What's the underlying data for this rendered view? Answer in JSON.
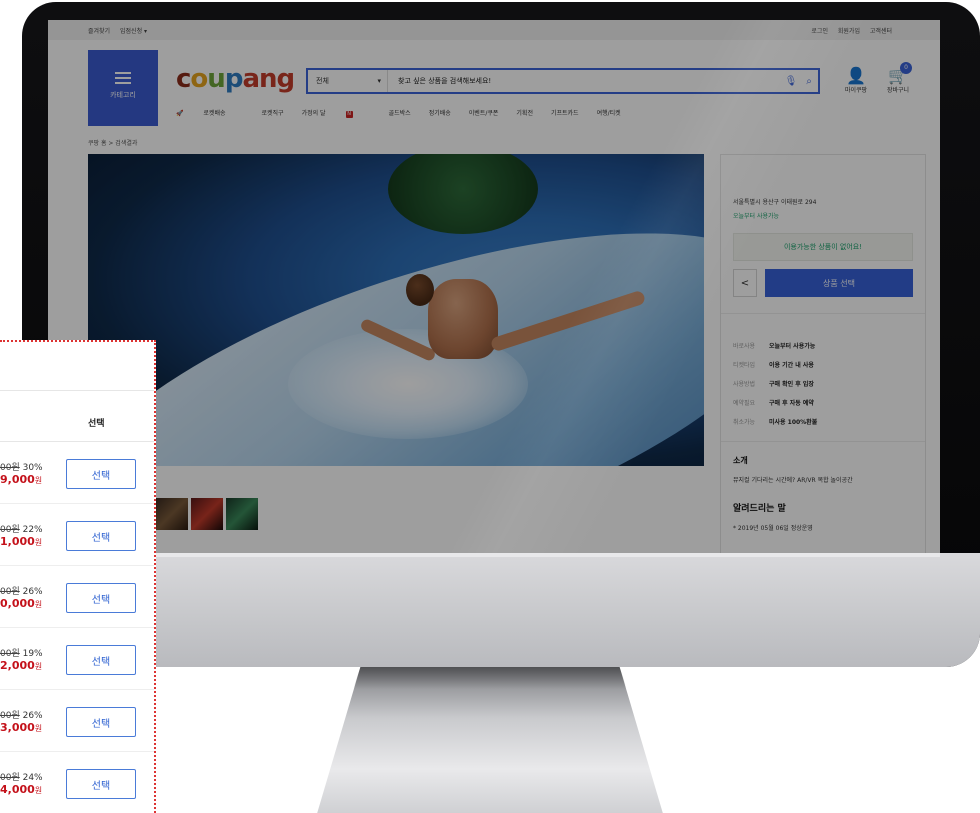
{
  "top_util": {
    "left": [
      "즐겨찾기",
      "입점신청 ▾"
    ],
    "right": [
      "로그인",
      "회원가입",
      "고객센터"
    ]
  },
  "category": {
    "label": "카테고리"
  },
  "logo": {
    "parts": [
      "c",
      "o",
      "u",
      "p",
      "ang"
    ]
  },
  "search": {
    "scope": "전체",
    "query": "찾고 싶은 상품을 검색해보세요!"
  },
  "user": {
    "label": "마이쿠팡"
  },
  "cart": {
    "label": "장바구니",
    "count": "0"
  },
  "nav": [
    "로켓배송",
    "로켓직구",
    "가정의 달",
    "골드박스",
    "정기배송",
    "이벤트/쿠폰",
    "기획전",
    "기프트카드",
    "여행/티켓"
  ],
  "breadcrumb": "쿠팡 홈 > 검색결과",
  "side": {
    "address": "서울특별시 용산구 이태원로 294",
    "today": "오늘부터 사용가능",
    "not_available": "이용가능한 상품이 없어요!",
    "select_button": "상품 선택",
    "info": [
      {
        "k": "바로사용",
        "v": "오늘부터 사용가능"
      },
      {
        "k": "티켓타입",
        "v": "이용 기간 내 사용"
      },
      {
        "k": "사용방법",
        "v": "구매 확인 후 입장"
      },
      {
        "k": "예약필요",
        "v": "구매 후 자동 예약"
      },
      {
        "k": "취소가능",
        "v": "미사용 100%환불"
      }
    ],
    "intro_title": "소개",
    "intro": "뮤지컬 기다리는 시간에? AR/VR 복합 놀이공간",
    "notice_title": "알려드리는 말",
    "notice": "* 2019년 05월 06일 정상운영"
  },
  "card": {
    "col_header": "선택",
    "rows": [
      {
        "was": "00원",
        "pct": "30%",
        "now": "9,000",
        "unit": "원",
        "btn": "선택"
      },
      {
        "was": "00원",
        "pct": "22%",
        "now": "1,000",
        "unit": "원",
        "btn": "선택"
      },
      {
        "was": "00원",
        "pct": "26%",
        "now": "0,000",
        "unit": "원",
        "btn": "선택"
      },
      {
        "was": "00원",
        "pct": "19%",
        "now": "2,000",
        "unit": "원",
        "btn": "선택"
      },
      {
        "was": "00원",
        "pct": "26%",
        "now": "3,000",
        "unit": "원",
        "btn": "선택"
      },
      {
        "was": "00원",
        "pct": "24%",
        "now": "4,000",
        "unit": "원",
        "btn": "선택"
      }
    ]
  }
}
